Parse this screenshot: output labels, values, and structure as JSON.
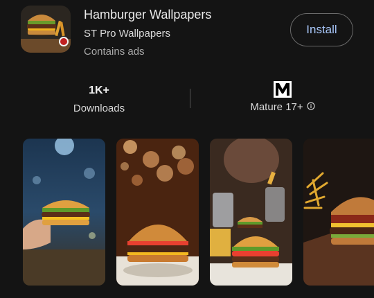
{
  "app": {
    "title": "Hamburger Wallpapers",
    "developer": "ST Pro Wallpapers",
    "ads_note": "Contains ads",
    "install_label": "Install",
    "icon": "hamburger-app-icon"
  },
  "stats": {
    "downloads_value": "1K+",
    "downloads_label": "Downloads",
    "rating_label": "Mature 17+",
    "rating_icon": "esrb-mature-icon",
    "info_icon": "info-icon"
  },
  "screenshots": [
    {
      "name": "screenshot-1",
      "subject": "hand holding burger"
    },
    {
      "name": "screenshot-2",
      "subject": "burger with bokeh lights"
    },
    {
      "name": "screenshot-3",
      "subject": "burger with fries and drink"
    },
    {
      "name": "screenshot-4",
      "subject": "bacon burger with fries"
    }
  ],
  "colors": {
    "background": "#141414",
    "install_text": "#a8c7fa",
    "text_primary": "#eaeaea",
    "text_secondary": "#a8a8a8"
  }
}
